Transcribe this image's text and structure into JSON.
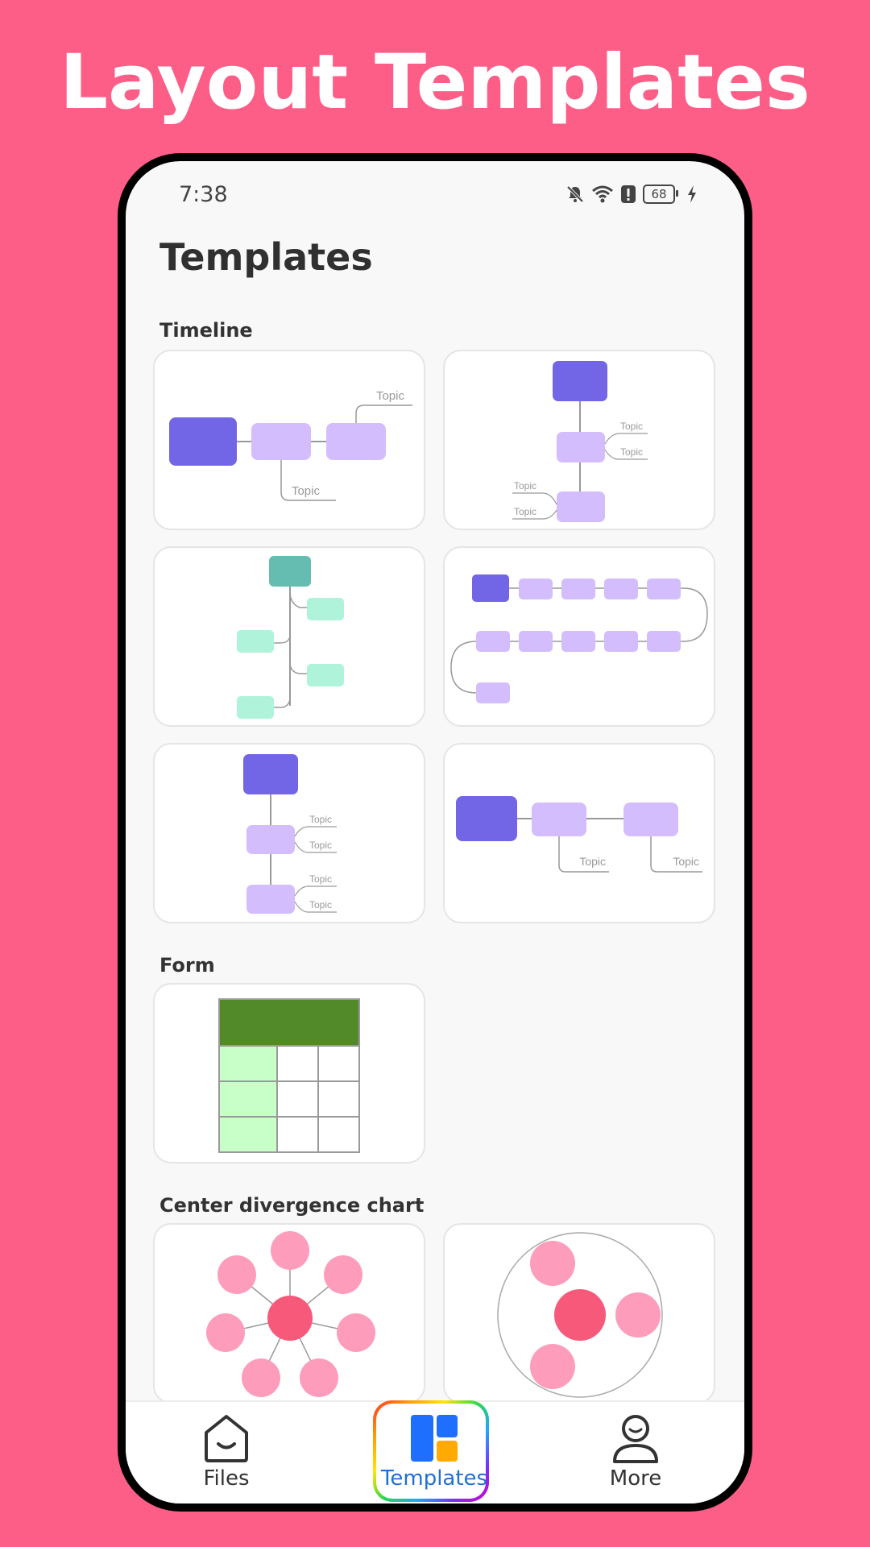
{
  "headline": "Layout Templates",
  "status": {
    "time": "7:38",
    "battery": "68"
  },
  "page": {
    "title": "Templates",
    "sections": {
      "timeline": "Timeline",
      "form": "Form",
      "center": "Center divergence chart"
    }
  },
  "diagram": {
    "topic": "Topic"
  },
  "colors": {
    "accent": "#fd5e87",
    "dark_purple": "#7366e6",
    "light_purple": "#d3bdfc",
    "teal": "#64bdb0",
    "mint": "#aef3da",
    "form_header": "#528a2a",
    "form_cell": "#c8ffc8",
    "center_node": "#f7597a",
    "pink_node": "#fd9dbb"
  },
  "nav": {
    "files": "Files",
    "templates": "Templates",
    "more": "More"
  }
}
